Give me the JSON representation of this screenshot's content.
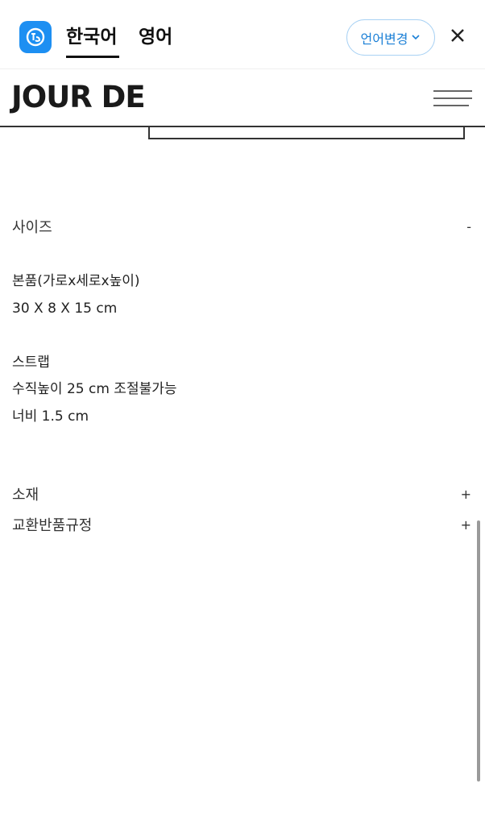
{
  "translate_bar": {
    "tabs": [
      {
        "label": "한국어"
      },
      {
        "label": "영어"
      }
    ],
    "change_language_label": "언어변경",
    "accent_color": "#1d8ff2"
  },
  "site": {
    "logo": "JOUR DE"
  },
  "sections": {
    "size": {
      "title": "사이즈",
      "toggle": "-"
    },
    "material": {
      "title": "소재",
      "toggle": "+"
    },
    "returns": {
      "title": "교환반품규정",
      "toggle": "+"
    }
  },
  "size_details": {
    "body_label": "본품(가로x세로x높이)",
    "body_value": "30 X 8 X 15 cm",
    "strap_label": "스트랩",
    "strap_height": "수직높이 25 cm 조절불가능",
    "strap_width": "너비 1.5 cm"
  }
}
